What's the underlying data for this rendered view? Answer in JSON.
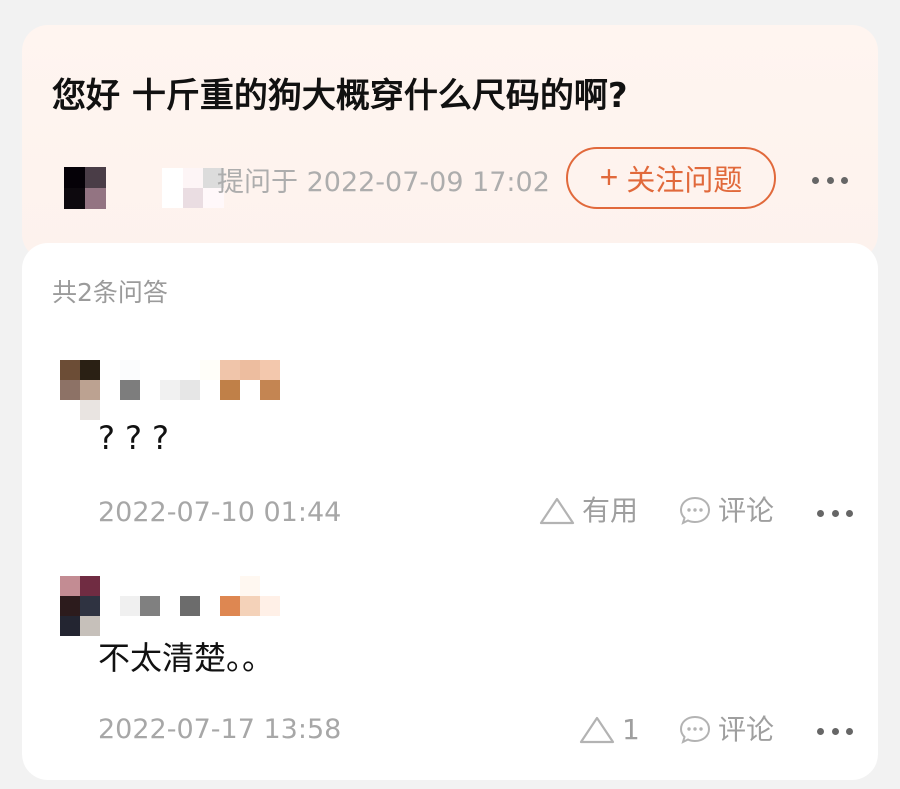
{
  "question": {
    "title": "您好 十斤重的狗大概穿什么尺码的啊?",
    "asked_label": "提问于 2022-07-09 17:02",
    "follow_button": {
      "plus": "+",
      "label": "关注问题"
    },
    "more_icon": "more-dots-icon"
  },
  "answers_summary": {
    "count_label": "共2条问答"
  },
  "answers": [
    {
      "text": "???",
      "timestamp": "2022-07-10 01:44",
      "useful_label": "有用",
      "comment_label": "评论",
      "useful_icon": "triangle-upvote-icon",
      "comment_icon": "speech-bubble-icon",
      "more_icon": "more-dots-icon"
    },
    {
      "text": "不太清楚。。",
      "timestamp": "2022-07-17 13:58",
      "useful_label": "1",
      "comment_label": "评论",
      "useful_icon": "triangle-upvote-icon",
      "comment_icon": "speech-bubble-icon",
      "more_icon": "more-dots-icon"
    }
  ],
  "colors": {
    "accent": "#e1693b",
    "page_background": "#f2f2f2",
    "question_background": "#fdf2ed",
    "muted_text": "#a7a7a7"
  }
}
